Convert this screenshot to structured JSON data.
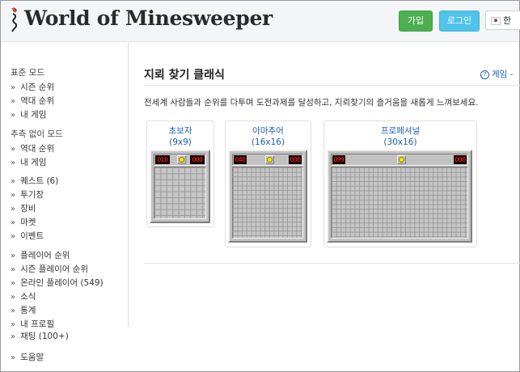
{
  "header": {
    "logo_text": "World of Minesweeper",
    "join_label": "가입",
    "login_label": "로그인",
    "language_label": "한"
  },
  "sidebar": {
    "sections": [
      {
        "heading": "표준 모드",
        "items": [
          "시즌 순위",
          "역대 순위",
          "내 게임"
        ]
      },
      {
        "heading": "추측 없이 모드",
        "items": [
          "역대 순위",
          "내 게임"
        ]
      },
      {
        "heading": "",
        "items": [
          "퀘스트 (6)",
          "투기장",
          "장비",
          "마켓",
          "이벤트"
        ]
      },
      {
        "heading": "",
        "items": [
          "플레이어 순위",
          "시즌 플레이어 순위",
          "온라인 플레이어 (549)",
          "소식",
          "통계",
          "내 프로필",
          "채팅 (100+)"
        ]
      },
      {
        "heading": "",
        "items": [
          "도움말"
        ]
      }
    ]
  },
  "main": {
    "title": "지뢰 찾기 클래식",
    "help_label": "게임 -",
    "description": "전세계 사람들과 순위를 다투며 도전과제를 달성하고, 지뢰찾기의 즐거움을 새롭게 느껴보세요.",
    "cards": [
      {
        "name": "초보자",
        "size": "(9x9)",
        "cols": 9,
        "rows": 9,
        "mines": "010",
        "time": "000"
      },
      {
        "name": "아마추어",
        "size": "(16x16)",
        "cols": 16,
        "rows": 16,
        "mines": "040",
        "time": "000"
      },
      {
        "name": "프로페셔널",
        "size": "(30x16)",
        "cols": 30,
        "rows": 16,
        "mines": "099",
        "time": "000"
      }
    ]
  },
  "colors": {
    "join": "#4caf50",
    "login": "#4fc3e8",
    "link": "#1a5fb4",
    "led_digits": "#ff2a2a",
    "face": "#ffe600"
  },
  "icons": [
    "logo-mine-icon",
    "korea-flag-icon",
    "help-circle-icon",
    "double-chevron-icon",
    "smiley-face-icon"
  ]
}
